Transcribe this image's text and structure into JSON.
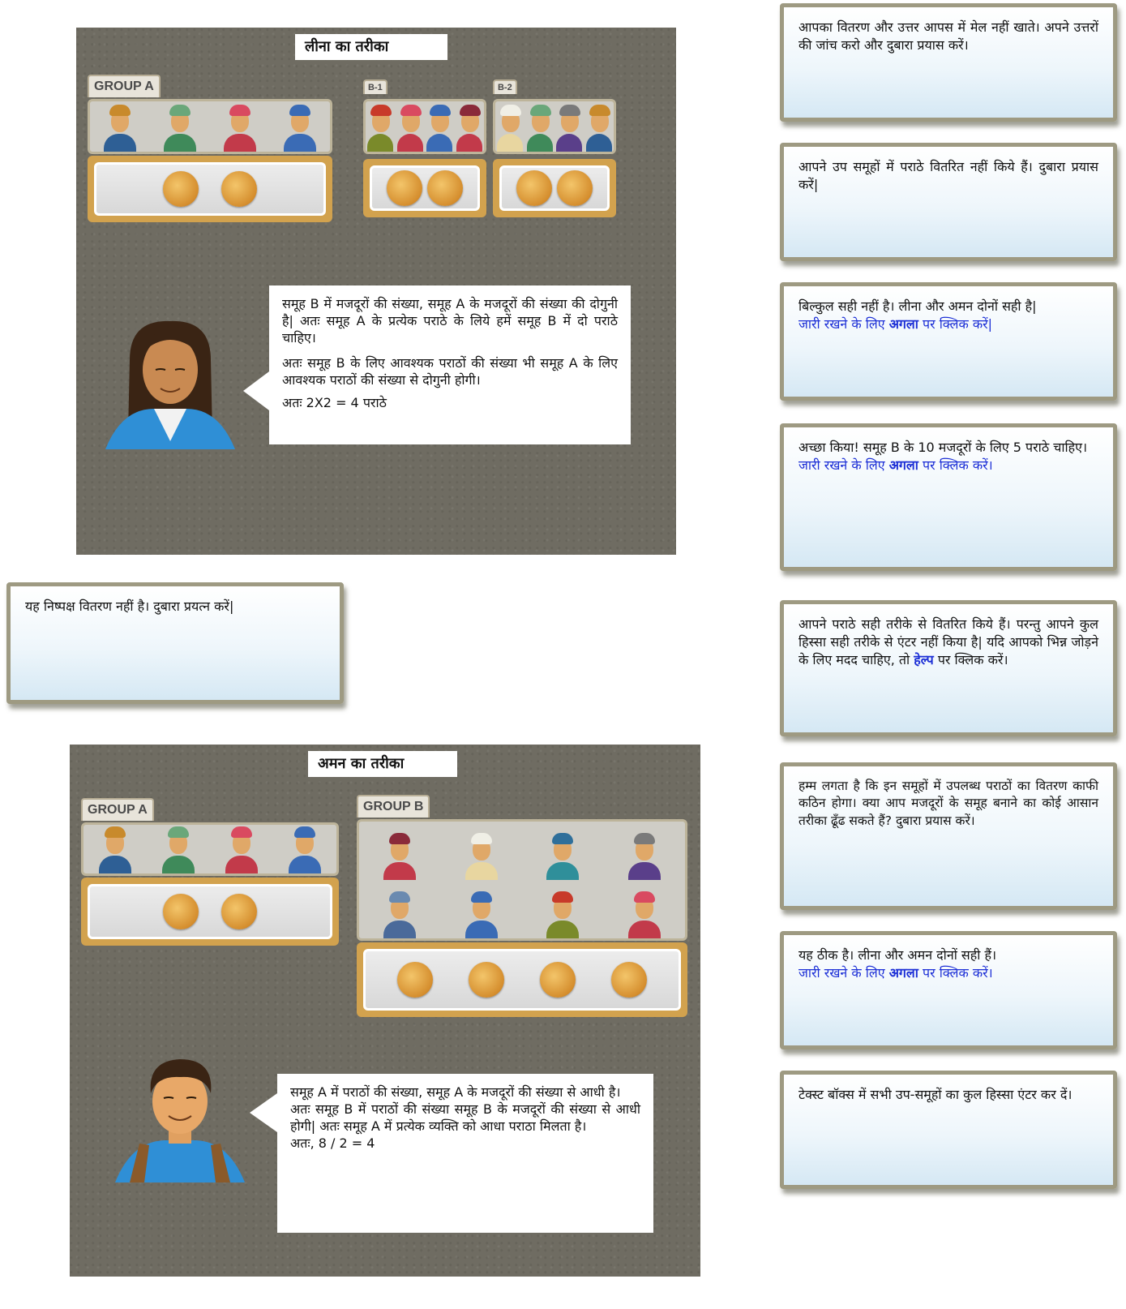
{
  "leena_panel": {
    "title": "लीना का तरीका",
    "group_a_label": "GROUP A",
    "b1_label": "B-1",
    "b2_label": "B-2",
    "speech": [
      "समूह B में मजदूरों की संख्या, समूह A के मजदूरों की संख्या की दोगुनी है| अतः समूह A के प्रत्येक पराठे के लिये हमें समूह B में दो पराठे चाहिए।",
      "अतः समूह B के लिए आवश्यक पराठों की संख्या भी समूह A के लिए आवश्यक पराठों की संख्या से दोगुनी होगी।",
      "अतः 2X2 = 4 पराठे"
    ]
  },
  "aman_panel": {
    "title": "अमन का तरीका",
    "group_a_label": "GROUP A",
    "group_b_label": "GROUP B",
    "speech": [
      "समूह A में पराठों की संख्या, समूह A के मजदूरों की संख्या से आधी है।",
      "अतः समूह B में पराठों की संख्या समूह B के मजदूरों की संख्या से आधी होगी| अतः समूह A में प्रत्येक व्यक्ति को आधा पराठा मिलता है।",
      "अतः, 8 / 2 = 4"
    ]
  },
  "left_message": "यह निष्पक्ष वितरण नहीं है। दुबारा   प्रयत्न करें|",
  "messages": [
    {
      "text": "आपका वितरण और उत्तर आपस में मेल नहीं खाते। अपने उत्तरों की जांच करो और दुबारा प्रयास करें।"
    },
    {
      "text": "आपने उप समूहों में पराठे वितरित नहीं किये हैं। दुबारा प्रयास करें|"
    },
    {
      "text": "बिल्कुल सही नहीं है। लीना और अमन  दोनों सही है|",
      "link_pre": " जारी रखने के लिए ",
      "link_bold": "अगला",
      "link_post": " पर क्लिक करें|"
    },
    {
      "text": "अच्छा किया! समूह B के 10 मजदूरों के लिए 5 पराठे चाहिए।",
      "link_pre": "जारी रखने के लिए ",
      "link_bold": "अगला",
      "link_post": " पर क्लिक करें।"
    },
    {
      "text": "आपने पराठे सही तरीके से वितरित किये हैं। परन्तु आपने कुल हिस्सा सही तरीके से एंटर नहीं किया है|  यदि आपको भिन्न जोड़ने के लिए मदद चाहिए, तो",
      "help_word": "हेल्प",
      "help_post": " पर क्लिक करें।"
    },
    {
      "text": "हम्म लगता है कि इन समूहों में उपलब्ध पराठों का वितरण काफी कठिन होगा। क्या आप मजदूरों के समूह बनाने का कोई आसान तरीका ढूँढ सकते हैं? दुबारा प्रयास करें।"
    },
    {
      "text": "यह ठीक है। लीना और अमन दोनों सही हैं।",
      "link_pre": "जारी रखने के लिए ",
      "link_bold": "अगला",
      "link_post": " पर क्लिक करें।"
    },
    {
      "text": "टेक्स्ट बॉक्स में सभी उप-समूहों का कुल हिस्सा एंटर कर दें।"
    }
  ],
  "colors": {
    "link": "#1b2ed6",
    "panel_bg": "#6f6c62",
    "tray": "#d2a24e",
    "box_border": "#9e9a82"
  }
}
